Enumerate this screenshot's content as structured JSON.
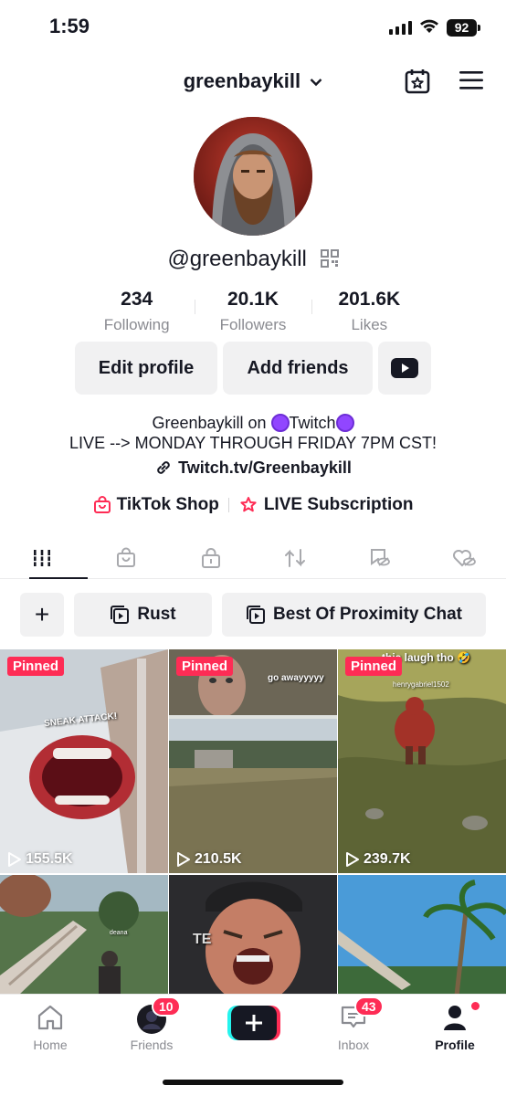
{
  "status": {
    "time": "1:59",
    "battery": "92"
  },
  "header": {
    "username": "greenbaykill"
  },
  "profile": {
    "handle": "@greenbaykill",
    "stats": [
      {
        "value": "234",
        "label": "Following"
      },
      {
        "value": "20.1K",
        "label": "Followers"
      },
      {
        "value": "201.6K",
        "label": "Likes"
      }
    ],
    "edit_label": "Edit profile",
    "add_friends_label": "Add friends",
    "bio_line1_pre": "Greenbaykill on ",
    "bio_line1_mid": "Twitch",
    "bio_line2": "LIVE --> MONDAY THROUGH FRIDAY 7PM CST!",
    "link": "Twitch.tv/Greenbaykill",
    "shop_label": "TikTok Shop",
    "live_sub_label": "LIVE Subscription"
  },
  "chips": {
    "add": "+",
    "rust": "Rust",
    "proximity": "Best Of Proximity Chat"
  },
  "videos": [
    {
      "pinned": "Pinned",
      "views": "155.5K",
      "caption": "SNEAK ATTACK!"
    },
    {
      "pinned": "Pinned",
      "views": "210.5K",
      "caption": "go awayyyyy"
    },
    {
      "pinned": "Pinned",
      "views": "239.7K",
      "caption": "this laugh tho 🤣",
      "sub": "henrygabriel1502"
    },
    {
      "caption": "deana"
    },
    {
      "caption": "TE"
    },
    {
      "caption": ""
    }
  ],
  "nav": {
    "home": "Home",
    "friends": "Friends",
    "friends_badge": "10",
    "inbox": "Inbox",
    "inbox_badge": "43",
    "profile": "Profile"
  },
  "colors": {
    "accent": "#fe2c55",
    "twitch": "#9146ff",
    "cyan": "#25f4ee"
  }
}
